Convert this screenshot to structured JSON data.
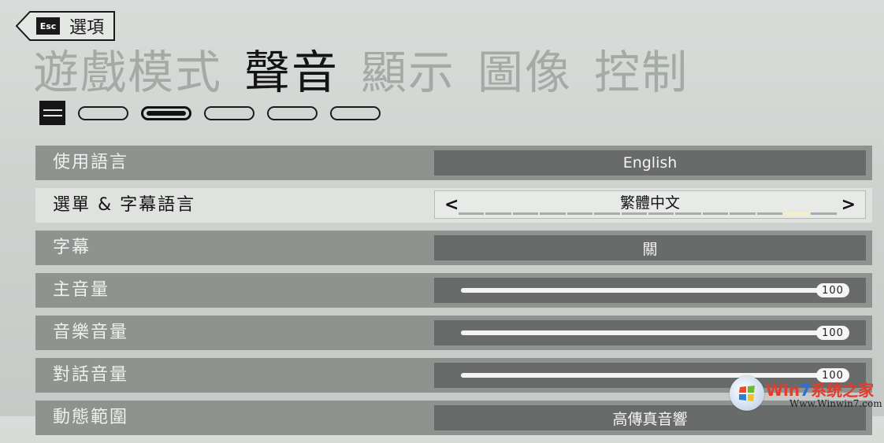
{
  "back": {
    "key_label": "Esc",
    "label": "選項"
  },
  "tabs": [
    {
      "label": "遊戲模式",
      "active": false
    },
    {
      "label": "聲音",
      "active": true
    },
    {
      "label": "顯示",
      "active": false
    },
    {
      "label": "圖像",
      "active": false
    },
    {
      "label": "控制",
      "active": false
    }
  ],
  "page_indicator": {
    "count": 5,
    "active_index": 1
  },
  "settings": [
    {
      "label": "使用語言",
      "type": "value",
      "value": "English"
    },
    {
      "label": "選單 & 字幕語言",
      "type": "selector",
      "value": "繁體中文",
      "options_count": 14,
      "selected_index": 12,
      "selected": true
    },
    {
      "label": "字幕",
      "type": "value",
      "value": "關"
    },
    {
      "label": "主音量",
      "type": "slider",
      "value": "100",
      "level": 1.0
    },
    {
      "label": "音樂音量",
      "type": "slider",
      "value": "100",
      "level": 1.0
    },
    {
      "label": "對話音量",
      "type": "slider",
      "value": "100",
      "level": 1.0
    },
    {
      "label": "動態範圍",
      "type": "value",
      "value": "高傳真音響"
    }
  ],
  "watermark": {
    "brand_w": "Win",
    "brand_num": "7",
    "brand_cn": "系统之家",
    "url": "Www.Winwin7.com"
  },
  "colors": {
    "active_tab": "#141414",
    "inactive_tab": "#a4aaa6",
    "row_bg": "#8f9390",
    "row_selected_bg": "#dfe2df",
    "control_bg": "#686b69",
    "segment_on": "#f4f0c4"
  }
}
